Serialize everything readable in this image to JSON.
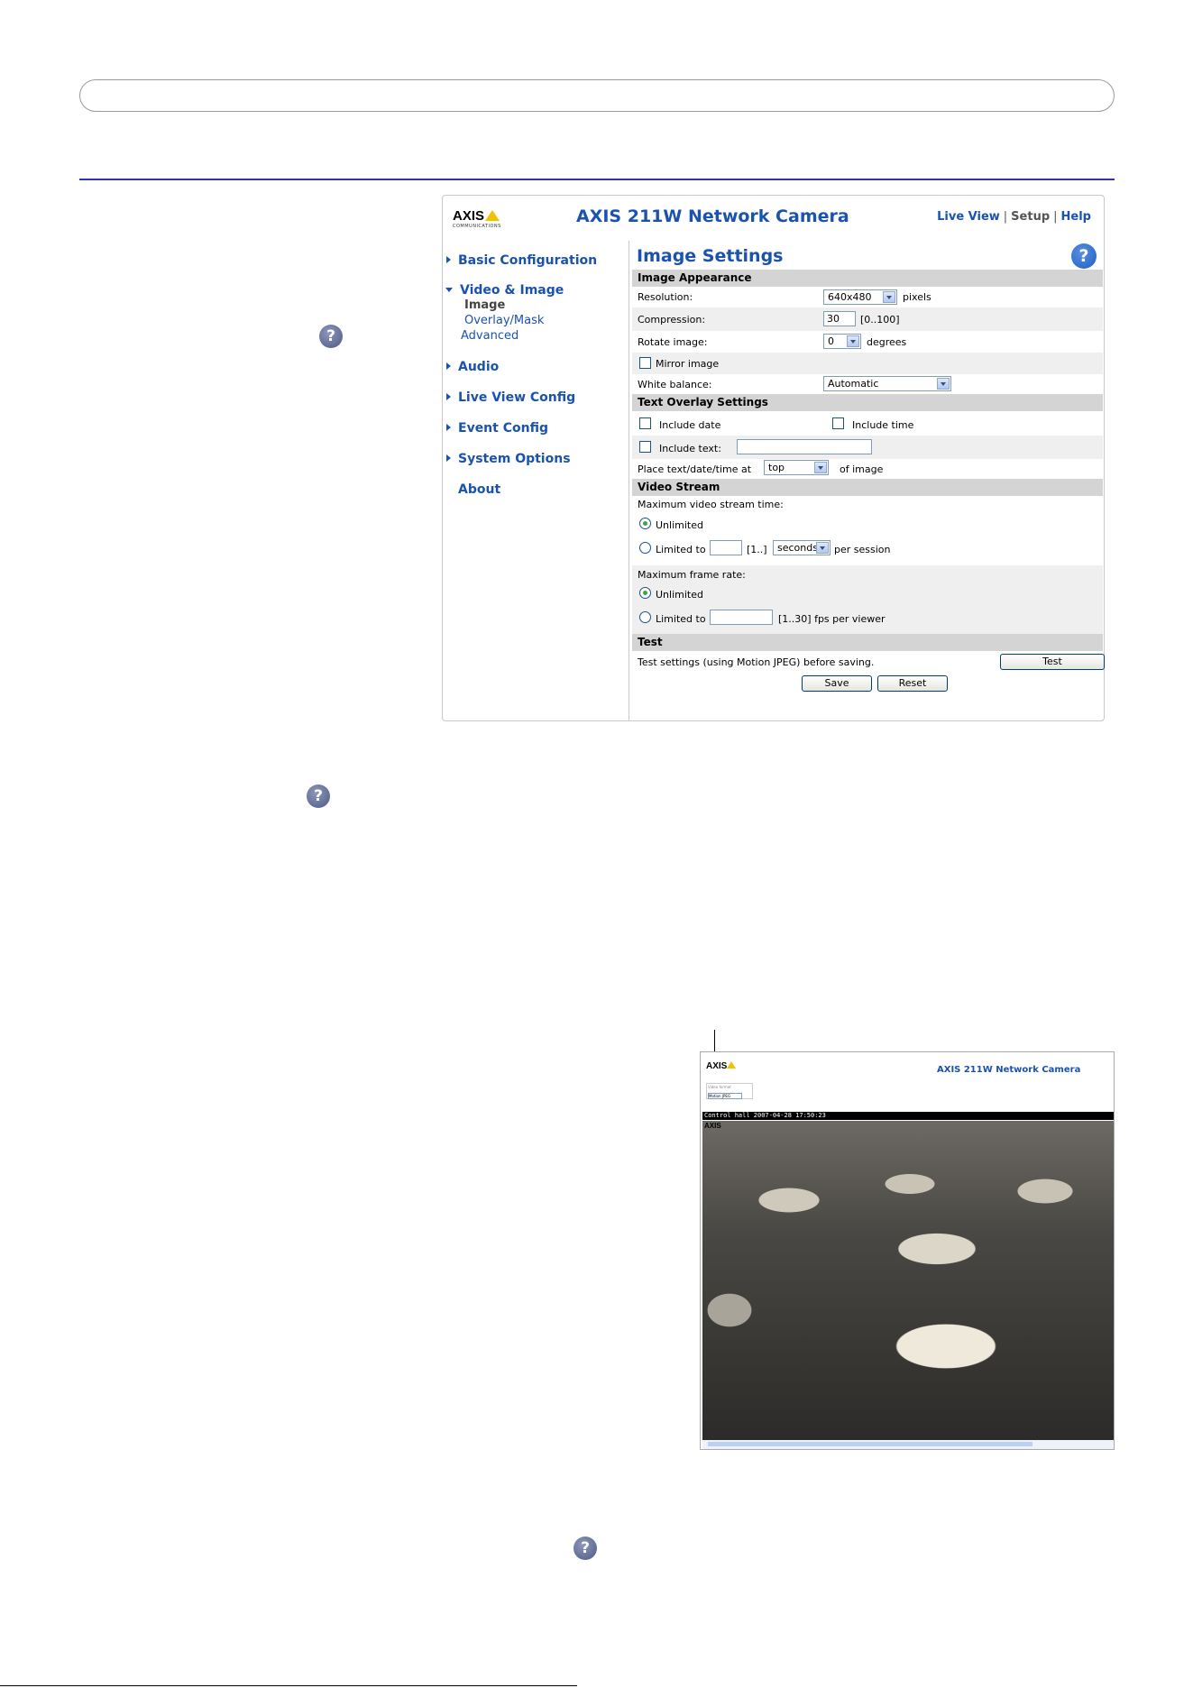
{
  "window": {
    "logo": "AXIS",
    "logo_sub": "COMMUNICATIONS",
    "app_title": "AXIS 211W Network Camera",
    "links": {
      "live_view": "Live View",
      "setup": "Setup",
      "help": "Help"
    }
  },
  "nav": {
    "basic": "Basic Configuration",
    "video_image": "Video & Image",
    "image": "Image",
    "overlay": "Overlay/Mask",
    "advanced": "Advanced",
    "audio": "Audio",
    "live_view_config": "Live View Config",
    "event_config": "Event Config",
    "system_options": "System Options",
    "about": "About"
  },
  "page": {
    "title": "Image Settings",
    "appearance": {
      "header": "Image Appearance",
      "resolution_label": "Resolution:",
      "resolution_value": "640x480",
      "resolution_unit": "pixels",
      "compression_label": "Compression:",
      "compression_value": "30",
      "compression_range": "[0..100]",
      "rotate_label": "Rotate image:",
      "rotate_value": "0",
      "rotate_unit": "degrees",
      "mirror_label": "Mirror image",
      "wb_label": "White balance:",
      "wb_value": "Automatic"
    },
    "overlay": {
      "header": "Text Overlay Settings",
      "include_date": "Include date",
      "include_time": "Include time",
      "include_text": "Include text:",
      "place_label": "Place text/date/time at",
      "place_value": "top",
      "place_suffix": "of image"
    },
    "stream": {
      "header": "Video Stream",
      "max_time_label": "Maximum video stream time:",
      "unlimited": "Unlimited",
      "limited_to": "Limited to",
      "time_range": "[1..]",
      "time_unit": "seconds",
      "per_session": "per session",
      "max_fps_label": "Maximum frame rate:",
      "unlimited2": "Unlimited",
      "limited_to2": "Limited to",
      "fps_range": "[1..30] fps per viewer"
    },
    "test": {
      "header": "Test",
      "desc": "Test settings (using Motion JPEG) before saving.",
      "test_button": "Test",
      "save_button": "Save",
      "reset_button": "Reset"
    }
  },
  "help_icons": {
    "glyph": "?"
  },
  "liveview": {
    "logo": "AXIS",
    "title": "AXIS 211W Network Camera",
    "video_format_label": "Video format",
    "video_format_value": "Motion JPEG",
    "overlay_text": "Control hall 2007-04-28 17:50:23",
    "overlay_logo": "AXIS"
  }
}
